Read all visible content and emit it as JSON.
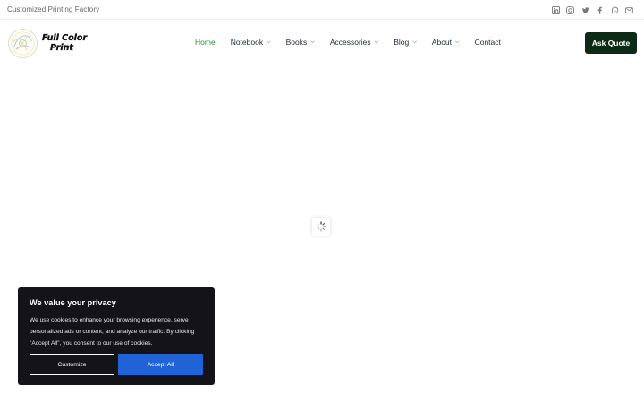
{
  "topbar": {
    "tagline": "Customized Printing Factory",
    "social": [
      {
        "icon": "linkedin-icon"
      },
      {
        "icon": "instagram-icon"
      },
      {
        "icon": "twitter-icon"
      },
      {
        "icon": "facebook-icon"
      },
      {
        "icon": "whatsapp-icon"
      },
      {
        "icon": "email-icon"
      }
    ]
  },
  "header": {
    "logo": {
      "line1": "Full Color",
      "line2": "Print"
    },
    "nav": [
      {
        "label": "Home",
        "active": true,
        "dropdown": false
      },
      {
        "label": "Notebook",
        "active": false,
        "dropdown": true
      },
      {
        "label": "Books",
        "active": false,
        "dropdown": true
      },
      {
        "label": "Accessories",
        "active": false,
        "dropdown": true
      },
      {
        "label": "Blog",
        "active": false,
        "dropdown": true
      },
      {
        "label": "About",
        "active": false,
        "dropdown": true
      },
      {
        "label": "Contact",
        "active": false,
        "dropdown": false
      }
    ],
    "cta": "Ask Quote"
  },
  "cookie": {
    "title": "We value your privacy",
    "text": "We use cookies to enhance your browsing experience, serve personalized ads or content, and analyze our traffic. By clicking \"Accept All\", you consent to our use of cookies.",
    "customize": "Customize",
    "accept": "Accept All"
  },
  "colors": {
    "accent_green": "#2f8d3b",
    "cta_bg": "#0c2a16",
    "accept_blue": "#1f63d6",
    "banner_bg": "#141418"
  }
}
